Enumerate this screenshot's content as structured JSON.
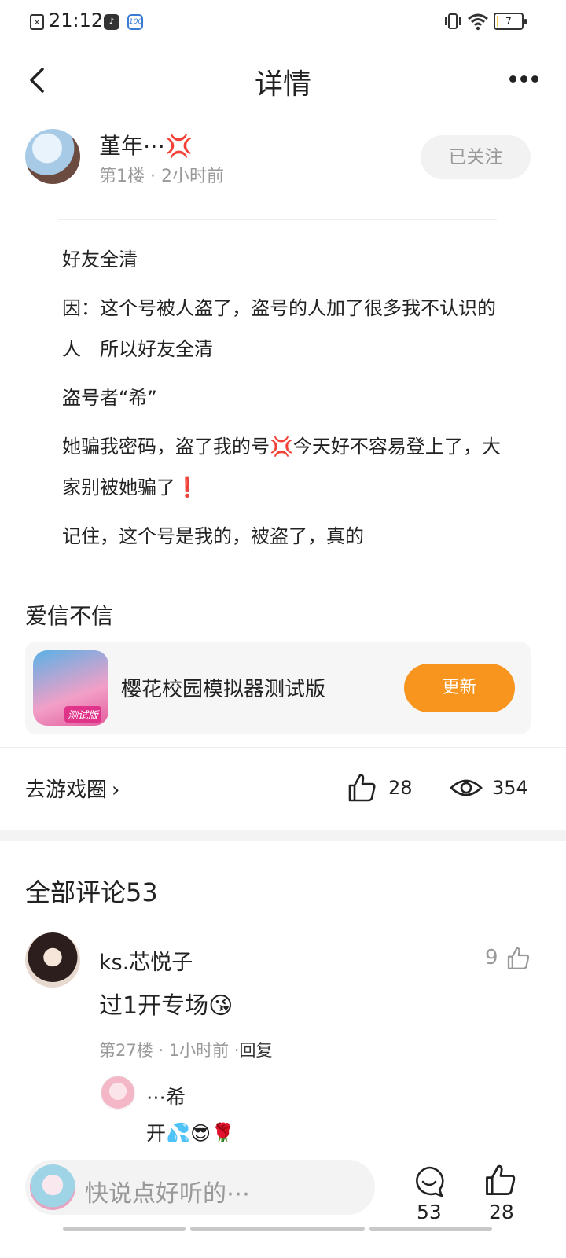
{
  "status_bar": {
    "time": "21:12",
    "battery": "7",
    "battery_level": 0.07,
    "icons": [
      "sim-off-icon",
      "app-notification-icon",
      "app-100-icon",
      "vibrate-icon",
      "wifi-icon",
      "battery-icon"
    ]
  },
  "header": {
    "title": "详情"
  },
  "author": {
    "name": "堇年⋯💢",
    "meta": "第1楼 · 2小时前",
    "follow_label": "已关注"
  },
  "post": {
    "paragraphs": [
      "好友全清",
      "因：这个号被人盗了，盗号的人加了很多我不认识的人　所以好友全清",
      "盗号者“希”",
      "她骗我密码，盗了我的号💢今天好不容易登上了，大家别被她骗了❗",
      "记住，这个号是我的，被盗了，真的"
    ]
  },
  "circle": {
    "title": "爱信不信",
    "game_name": "樱花校园模拟器测试版",
    "game_tag": "测试版",
    "update_label": "更新",
    "go_label": "去游戏圈",
    "likes": "28",
    "views": "354"
  },
  "comments": {
    "title": "全部评论53",
    "items": [
      {
        "user": "ks.芯悦子",
        "likes": "9",
        "text": "过1开专场😘",
        "meta": "第27楼 · 1小时前 ·",
        "reply_label": "回复",
        "replies": [
          {
            "user": "⋯希",
            "text": "开💦😎🌹"
          }
        ]
      }
    ]
  },
  "bottom_bar": {
    "placeholder": "快说点好听的⋯",
    "comment_count": "53",
    "like_count": "28"
  },
  "colors": {
    "accent": "#f7951e",
    "muted_text": "#999999",
    "card_bg": "#f6f6f6"
  }
}
